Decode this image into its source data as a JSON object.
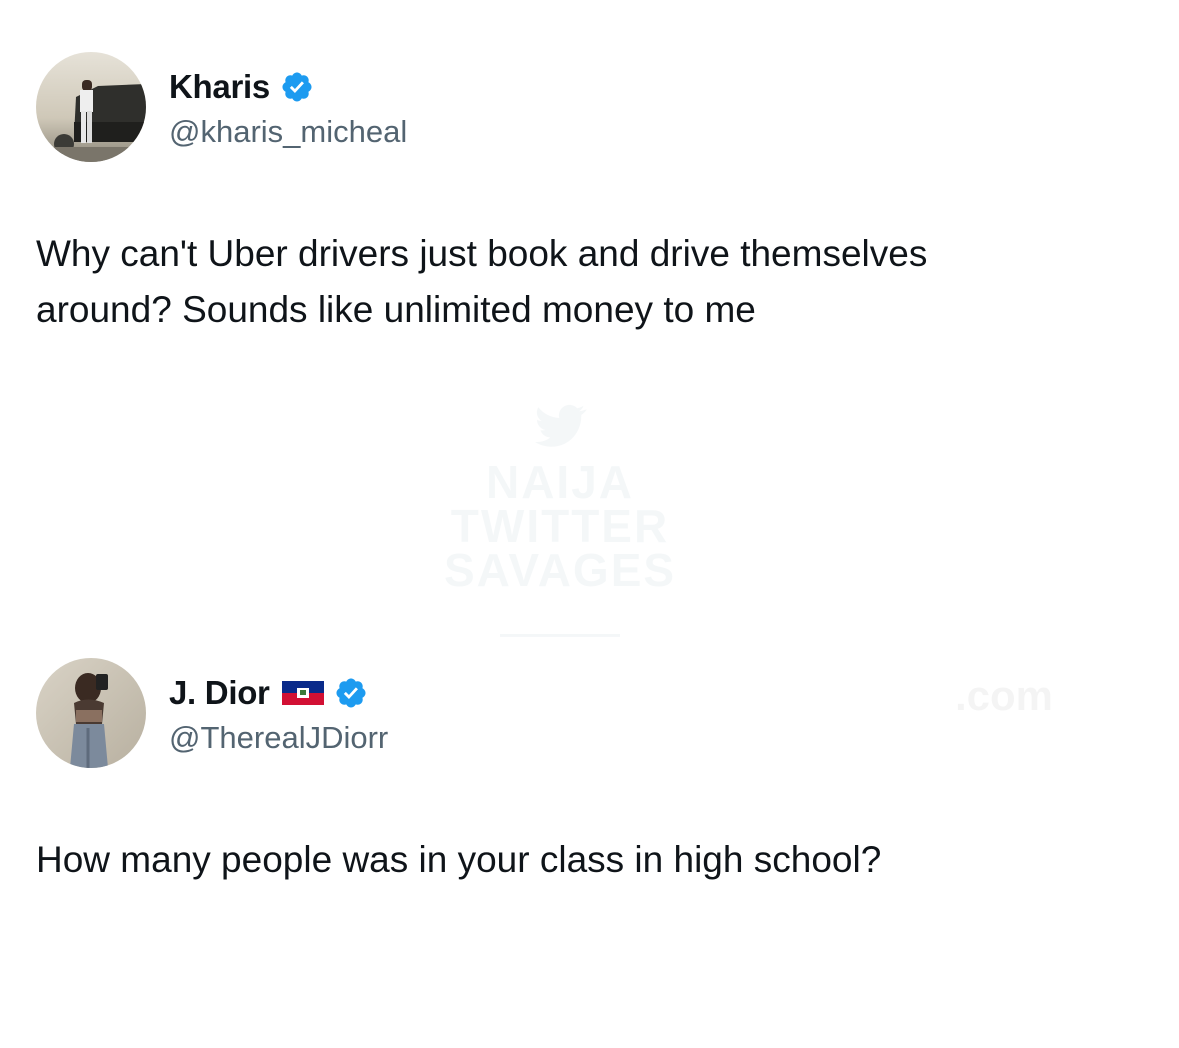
{
  "watermark": {
    "lines": [
      "NAIJA",
      "TWITTER",
      "SAVAGES"
    ],
    "ghost_text": ".com"
  },
  "tweets": [
    {
      "display_name": "Kharis",
      "handle": "@kharis_micheal",
      "verified": true,
      "avatar_icon": "profile-photo-icon",
      "text": "Why can't Uber drivers just book and drive themselves\naround? Sounds like unlimited money to me"
    },
    {
      "display_name": "J. Dior",
      "flag_icon": "haiti-flag-icon",
      "handle": "@TherealJDiorr",
      "verified": true,
      "avatar_icon": "profile-photo-icon",
      "text": "How many people was in your class in high school?"
    }
  ],
  "colors": {
    "verified_blue": "#1d9bf0",
    "handle_gray": "#536471",
    "text_black": "#0f1419"
  }
}
